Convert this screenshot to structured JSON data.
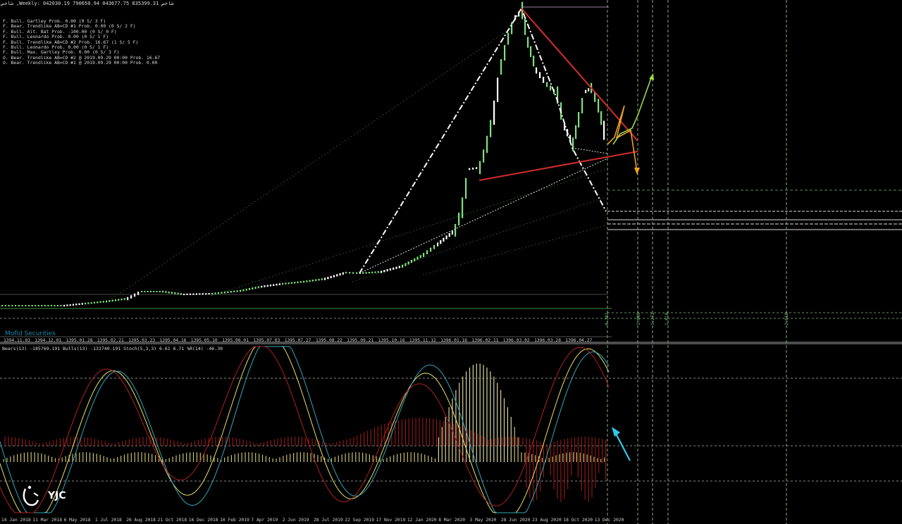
{
  "header": {
    "text": "شاخص ,Weekly: 042030.19 790650.94 043677.75 835399.31 شاخص"
  },
  "patterns": [
    "F. Bull. Gartley Prob. 0.00 (0 S/ 3 F)",
    "F. Bear. Trendlike AB=CD #1 Prob. 0.00 (0 S/ 2 F)",
    "F. Bull. Alt. Bat Prob. -100.00 (0 S/ 0 F)",
    "F. Bull. Leonardo Prob. 0.00 (0 S/ 1 F)",
    "F. Bull. Trendlike AB=CD #2 Prob. 16.67 (1 S/ 5 F)",
    "F. Bull. Leonardo Prob. 0.00 (0 S/ 1 F)",
    "F. Bull. Max. Gartley Prob. 0.00 (0 S/ 3 F)",
    "O. Bear. Trendlike AB=CD #2 @ 2019.09.29 00:00 Prob. 16.67",
    "O. Bear. Trendlike AB=CD #1 @ 2019.09.29 00:00 Prob. 0.00"
  ],
  "brand": "Mofid Securities",
  "indicator_label": "Bears(13) -185769.191 Bulls(13) -132740.191 Stoch(5,3,3) 6.61 6.71 %R(14) -46.30",
  "upper_dates": [
    "1394.11.03",
    "1394.12.01",
    "1395.01.28",
    "1395.02.21",
    "1395.03.23",
    "1395.04.16",
    "1395.05.10",
    "1395.06.01",
    "1395.07.03",
    "1395.07.27",
    "1395.08.22",
    "1395.09.21",
    "1395.10.16",
    "1395.11.12",
    "1396.01.16",
    "1396.02.11",
    "1396.03.02",
    "1396.03.28",
    "1396.04.27"
  ],
  "lower_dates": [
    "14 Jan 2018",
    "11 Mar 2018",
    "6 May 2018",
    "1 Jul 2018",
    "26 Aug 2018",
    "21 Oct 2018",
    "16 Dec 2018",
    "10 Feb 2019",
    "7 Apr 2019",
    "2 Jun 2019",
    "28 Jul 2019",
    "22 Sep 2019",
    "17 Nov 2019",
    "12 Jan 2020",
    "8 Mar 2020",
    "3 May 2020",
    "28 Jun 2020",
    "23 Aug 2020",
    "18 Oct 2020",
    "13 Dec 2020"
  ],
  "vertical_labels": [
    "0.382",
    "1.000",
    "1.272",
    "1.618",
    "2.618"
  ],
  "logo": "YJC",
  "colors": {
    "background": "#000000",
    "bull_candle": "#7fe07f",
    "pattern_red": "#d42c2c",
    "arrow_green": "#9bd84a",
    "arrow_orange": "#f0a020",
    "arrow_cyan": "#2ec9e8",
    "stoch_yellow": "#e8e06a",
    "stoch_cyan": "#2fa6b8"
  }
}
